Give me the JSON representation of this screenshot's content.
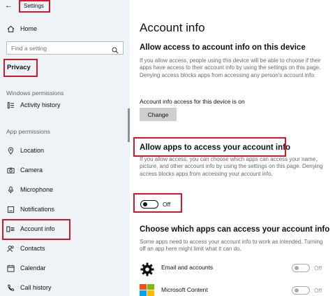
{
  "sidebar": {
    "app_title": "Settings",
    "home_label": "Home",
    "search_placeholder": "Find a setting",
    "privacy_label": "Privacy",
    "windows_permissions_label": "Windows permissions",
    "activity_history_label": "Activity history",
    "app_permissions_label": "App permissions",
    "items": [
      {
        "label": "Location",
        "icon": "location-icon"
      },
      {
        "label": "Camera",
        "icon": "camera-icon"
      },
      {
        "label": "Microphone",
        "icon": "microphone-icon"
      },
      {
        "label": "Notifications",
        "icon": "notifications-icon"
      },
      {
        "label": "Account info",
        "icon": "account-info-icon"
      },
      {
        "label": "Contacts",
        "icon": "contacts-icon"
      },
      {
        "label": "Calendar",
        "icon": "calendar-icon"
      },
      {
        "label": "Call history",
        "icon": "call-history-icon"
      }
    ]
  },
  "main": {
    "title": "Account info",
    "section1": {
      "heading": "Allow access to account info on this device",
      "description": "If you allow access, people using this device will be able to choose if their apps have access to their account info by using the settings on this page. Denying access blocks apps from accessing any person's account info.",
      "status": "Account info access for this device is on",
      "change_label": "Change"
    },
    "section2": {
      "heading": "Allow apps to access your account info",
      "description": "If you allow access, you can choose which apps can access your name, picture, and other account info by using the settings on this page. Denying access blocks apps from accessing your account info.",
      "toggle_state": "Off"
    },
    "section3": {
      "heading": "Choose which apps can access your account info",
      "description": "Some apps need to access your account info to work as intended. Turning off an app here might limit what it can do.",
      "apps": [
        {
          "name": "Email and accounts",
          "state": "Off",
          "icon": "gear-icon"
        },
        {
          "name": "Microsoft Content",
          "state": "Off",
          "icon": "microsoft-logo-icon"
        }
      ]
    }
  },
  "colors": {
    "highlight_red": "#d2192b",
    "sidebar_bg": "#eef3f8",
    "button_gray": "#cfcfcf"
  }
}
